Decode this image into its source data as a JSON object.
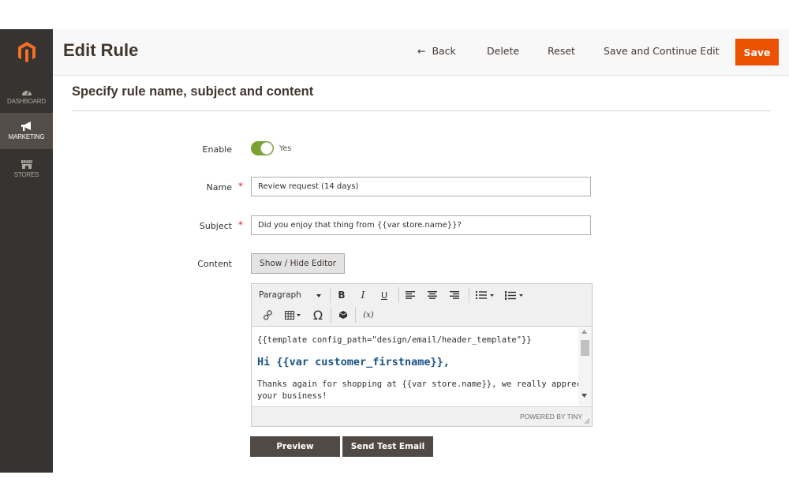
{
  "colors": {
    "sidebar_bg": "#373330",
    "sidebar_active": "#524d49",
    "accent": "#eb5202",
    "toggle_on": "#79a22e",
    "required": "#e22626",
    "greeting": "#1a5386",
    "dark_button": "#514943"
  },
  "sidebar": {
    "logo_icon": "magento-logo-icon",
    "items": [
      {
        "label": "DASHBOARD",
        "icon": "speedometer-icon",
        "active": false
      },
      {
        "label": "MARKETING",
        "icon": "megaphone-icon",
        "active": true
      },
      {
        "label": "STORES",
        "icon": "storefront-icon",
        "active": false
      }
    ]
  },
  "header": {
    "title": "Edit Rule",
    "back_arrow": "←",
    "back_label": "Back",
    "delete_label": "Delete",
    "reset_label": "Reset",
    "save_continue_label": "Save and Continue Edit",
    "save_label": "Save"
  },
  "section": {
    "title": "Specify rule name, subject and content"
  },
  "form": {
    "enable": {
      "label": "Enable",
      "state_text": "Yes",
      "checked": true
    },
    "name": {
      "label": "Name",
      "required_mark": "*",
      "value": "Review request (14 days)"
    },
    "subject": {
      "label": "Subject",
      "required_mark": "*",
      "value": "Did you enjoy that thing from {{var store.name}}?"
    },
    "content": {
      "label": "Content",
      "toggle_editor_label": "Show / Hide Editor"
    }
  },
  "editor": {
    "format_select": "Paragraph",
    "toolbar": {
      "bold": "B",
      "italic": "I",
      "underline": "U",
      "special_char": "Ω",
      "variable": "(x)"
    },
    "content": {
      "template_line": "{{template config_path=\"design/email/header_template\"}}",
      "greeting": "Hi {{var customer_firstname}},",
      "body_line1": "Thanks again for shopping at {{var store.name}}, we really appreciate",
      "body_line2": "your business!"
    },
    "powered_by": "POWERED BY TINY"
  },
  "actions": {
    "preview_label": "Preview",
    "test_email_label": "Send Test Email"
  }
}
